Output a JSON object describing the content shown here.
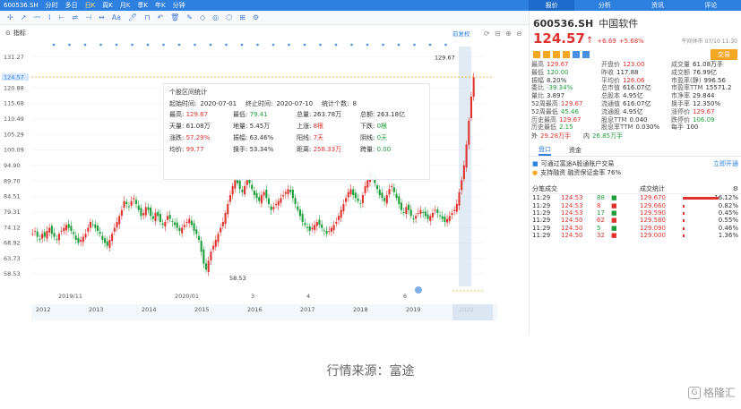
{
  "topbar": {
    "code": "600536.SH",
    "tabs": [
      "分时",
      "多日",
      "日K",
      "周K",
      "月K",
      "季K",
      "年K",
      "分钟"
    ],
    "active": "日K",
    "right_items": [
      "显示",
      "✓"
    ],
    "panel_tabs": [
      "报价",
      "分析",
      "资讯",
      "评论"
    ]
  },
  "toolbar": {
    "items": [
      "✢",
      "↗",
      "〰",
      "⌇",
      "⊢",
      "⇌",
      "⊣",
      "↔",
      "Aa",
      "🖊",
      "⊓",
      "↶",
      "🗑",
      "✎",
      "◇",
      "◎",
      "⬡",
      "⊞",
      "⚙"
    ]
  },
  "indicator": {
    "label": "指标",
    "compare": "前复权",
    "markers": [
      "⟳",
      "⊟",
      "⊕",
      "⊖"
    ]
  },
  "chart_data": {
    "type": "candlestick",
    "title": "",
    "yticks": [
      131.27,
      124.57,
      120.88,
      115.68,
      110.49,
      105.29,
      100.09,
      94.9,
      89.7,
      84.51,
      79.31,
      74.12,
      68.92,
      63.73,
      58.53
    ],
    "current_price_label": "124.57",
    "high_label": "129.67",
    "low_label": "58.53",
    "x_years": [
      "2012",
      "2013",
      "2014",
      "2015",
      "2016",
      "2017",
      "2018",
      "2019",
      "2020"
    ],
    "x_months": [
      "2019/11",
      "2020/01",
      "3",
      "4",
      "6"
    ],
    "series_hint": "2019-09 to 2020-07 daily candles",
    "closes": [
      72,
      73,
      71,
      70,
      72,
      71,
      73,
      74,
      72,
      71,
      70,
      72,
      73,
      74,
      75,
      74,
      73,
      72,
      70,
      69,
      70,
      71,
      72,
      74,
      76,
      75,
      74,
      73,
      72,
      70,
      69,
      68,
      70,
      72,
      74,
      76,
      78,
      80,
      83,
      82,
      81,
      83,
      84,
      82,
      80,
      78,
      79,
      81,
      80,
      78,
      77,
      79,
      78,
      76,
      75,
      76,
      78,
      77,
      76,
      75,
      74,
      73,
      74,
      75,
      76,
      77,
      75,
      73,
      72,
      70,
      66,
      62,
      60,
      63,
      66,
      68,
      70,
      72,
      74,
      76,
      79,
      82,
      85,
      88,
      90,
      89,
      87,
      86,
      88,
      90,
      89,
      87,
      85,
      84,
      83,
      85,
      86,
      84,
      82,
      80,
      81,
      82,
      83,
      84,
      85,
      86,
      87,
      86,
      84,
      82,
      80,
      78,
      76,
      75,
      74,
      73,
      74,
      75,
      76,
      75,
      74,
      73,
      72,
      73,
      74,
      75,
      76,
      78,
      80,
      82,
      84,
      86,
      87,
      85,
      84,
      83,
      82,
      85,
      88,
      90,
      92,
      91,
      89,
      87,
      85,
      84,
      83,
      85,
      87,
      88,
      86,
      84,
      82,
      80,
      79,
      81,
      80,
      78,
      77,
      78,
      79,
      80,
      79,
      78,
      77,
      78,
      79,
      80,
      79,
      78,
      77,
      76,
      77,
      78,
      79,
      80,
      82,
      86,
      90,
      95,
      102,
      110,
      118,
      124.57
    ]
  },
  "popup": {
    "title": "个股区间统计",
    "start_label": "起始时间:",
    "start": "2020-07-01",
    "end_label": "终止时间:",
    "end": "2020-07-10",
    "count_label": "统计个数:",
    "count": "8",
    "rows": [
      [
        [
          "最高:",
          "129.67",
          "red"
        ],
        [
          "最低:",
          "79.41",
          "green"
        ],
        [
          "总量:",
          "263.78万",
          ""
        ],
        [
          "总额:",
          "263.18亿",
          ""
        ]
      ],
      [
        [
          "天量:",
          "61.08万",
          ""
        ],
        [
          "地量:",
          "5.45万",
          ""
        ],
        [
          "上涨:",
          "8根",
          "red"
        ],
        [
          "下跌:",
          "0根",
          "green"
        ]
      ],
      [
        [
          "涨跌:",
          "57.29%",
          "red"
        ],
        [
          "振幅:",
          "63.46%",
          ""
        ],
        [
          "阳线:",
          "7天",
          "red"
        ],
        [
          "阴线:",
          "0天",
          "green"
        ]
      ],
      [
        [
          "均价:",
          "99.77",
          "red"
        ],
        [
          "换手:",
          "53.34%",
          ""
        ],
        [
          "距离:",
          "258.33万",
          "red"
        ],
        [
          "跨量:",
          "0.00",
          "green"
        ]
      ]
    ]
  },
  "quote": {
    "code": "600536.SH",
    "name": "中国软件",
    "price": "124.57",
    "arrow": "↑",
    "change": "+6.69",
    "pct": "+5.68%",
    "time": "午间休市 07/10 11:30",
    "btn": "交易",
    "grid": [
      [
        "最高",
        "129.67",
        "red"
      ],
      [
        "开盘价",
        "123.00",
        "red"
      ],
      [
        "成交量",
        "61.08万手",
        ""
      ],
      [
        "最低",
        "120.00",
        "green"
      ],
      [
        "昨收",
        "117.88",
        ""
      ],
      [
        "成交额",
        "76.99亿",
        ""
      ],
      [
        "振幅",
        "8.20%",
        ""
      ],
      [
        "平均价",
        "126.06",
        "red"
      ],
      [
        "市盈率(静)",
        "996.56",
        ""
      ],
      [
        "委比",
        "-39.34%",
        "green"
      ],
      [
        "总市值",
        "616.07亿",
        ""
      ],
      [
        "市盈率TTM",
        "15571.2",
        ""
      ],
      [
        "量比",
        "3.897",
        ""
      ],
      [
        "总股本",
        "4.95亿",
        ""
      ],
      [
        "市净率",
        "29.844",
        ""
      ],
      [
        "52周最高",
        "129.67",
        "red"
      ],
      [
        "流通值",
        "616.07亿",
        ""
      ],
      [
        "换手率",
        "12.350%",
        ""
      ],
      [
        "52周最低",
        "45.46",
        "green"
      ],
      [
        "流通股",
        "4.95亿",
        ""
      ],
      [
        "涨停价",
        "129.67",
        "red"
      ],
      [
        "历史最高",
        "129.67",
        "red"
      ],
      [
        "股息TTM",
        "0.040",
        ""
      ],
      [
        "跌停价",
        "106.09",
        "green"
      ],
      [
        "历史最低",
        "2.15",
        "green"
      ],
      [
        "股息率TTM",
        "0.030%",
        ""
      ],
      [
        "每手",
        "100",
        ""
      ]
    ],
    "outer_label": "外",
    "outer": "29.28万手",
    "inner_label": "内",
    "inner": "26.85万手",
    "tabs": [
      "盘口",
      "资金"
    ],
    "notices": [
      "可通过富途A股通账户交易",
      "支持融资 融资保证金率 76%"
    ],
    "notice_link": "立即开通",
    "ticks_title": "分笔成交",
    "stats_title": "成交统计",
    "ticks": [
      [
        "11:29",
        "124.53",
        "88",
        ""
      ],
      [
        "11:29",
        "124.53",
        "8",
        ""
      ],
      [
        "11:29",
        "124.53",
        "17",
        ""
      ],
      [
        "11:29",
        "124.50",
        "62",
        ""
      ],
      [
        "11:29",
        "124.50",
        "5",
        ""
      ],
      [
        "11:29",
        "124.50",
        "32",
        ""
      ]
    ],
    "stats": [
      [
        "129.670",
        "16.12%"
      ],
      [
        "129.660",
        "0.82%"
      ],
      [
        "129.590",
        "0.45%"
      ],
      [
        "129.580",
        "0.55%"
      ],
      [
        "129.090",
        "0.46%"
      ],
      [
        "129.000",
        "1.36%"
      ]
    ]
  },
  "caption": "行情来源：富途",
  "logo": "格隆汇"
}
